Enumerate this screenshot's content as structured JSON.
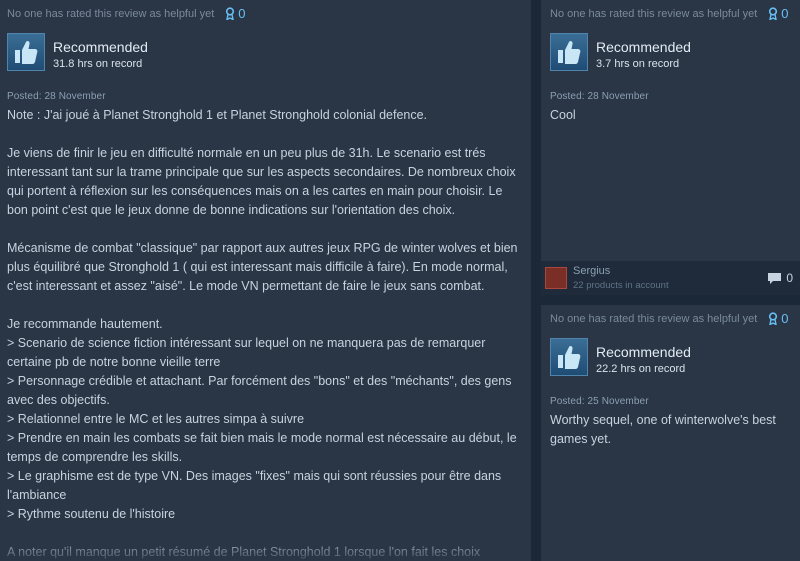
{
  "reviews": [
    {
      "helpful_text": "No one has rated this review as helpful yet",
      "award_count": "0",
      "verdict": "Recommended",
      "hours": "31.8 hrs on record",
      "posted": "Posted: 28 November",
      "body": "Note : J'ai joué à Planet Stronghold 1 et Planet Stronghold colonial defence.\n\nJe viens de finir le jeu en difficulté normale en un peu plus de 31h. Le scenario est trés interessant tant sur la trame principale que sur les aspects secondaires. De nombreux choix qui portent à réflexion sur les conséquences mais on a les cartes en main pour choisir. Le bon point c'est que le jeux donne de bonne indications sur l'orientation des choix.\n\nMécanisme de combat \"classique\" par rapport aux autres jeux RPG de winter wolves et bien plus équilibré que Stronghold 1 ( qui est interessant mais difficile à faire). En mode normal, c'est interessant et assez \"aisé\". Le mode VN permettant de faire le jeux sans combat.\n\nJe recommande hautement.\n> Scenario de science fiction intéressant sur lequel on ne manquera pas de remarquer certaine pb de notre bonne vieille terre\n> Personnage crédible et attachant. Par forcément des \"bons\" et des \"méchants\", des gens avec des objectifs.\n> Relationnel entre le MC et les autres simpa à suivre\n> Prendre en main les combats se fait bien mais le mode normal est nécessaire au début, le temps de comprendre les skills.\n> Le graphisme est de type VN. Des images \"fixes\" mais qui sont réussies pour être dans l'ambiance\n> Rythme soutenu de l'histoire\n\nA noter qu'il manque un petit résumé de Planet Stronghold 1 lorsque l'on fait les choix"
    },
    {
      "helpful_text": "No one has rated this review as helpful yet",
      "award_count": "0",
      "verdict": "Recommended",
      "hours": "3.7 hrs on record",
      "posted": "Posted: 28 November",
      "body": "Cool",
      "author": {
        "name": "Sergius",
        "products": "22 products in account"
      },
      "comment_count": "0"
    },
    {
      "helpful_text": "No one has rated this review as helpful yet",
      "award_count": "0",
      "verdict": "Recommended",
      "hours": "22.2 hrs on record",
      "posted": "Posted: 25 November",
      "body": "Worthy sequel, one of winterwolve's best games yet."
    }
  ],
  "colors": {
    "background": "#1b2838",
    "card": "#2a3545",
    "accent": "#66c0f4"
  },
  "icons": {
    "award": "award-ribbon-icon",
    "thumb": "thumbs-up-icon",
    "comment": "comment-bubble-icon"
  }
}
